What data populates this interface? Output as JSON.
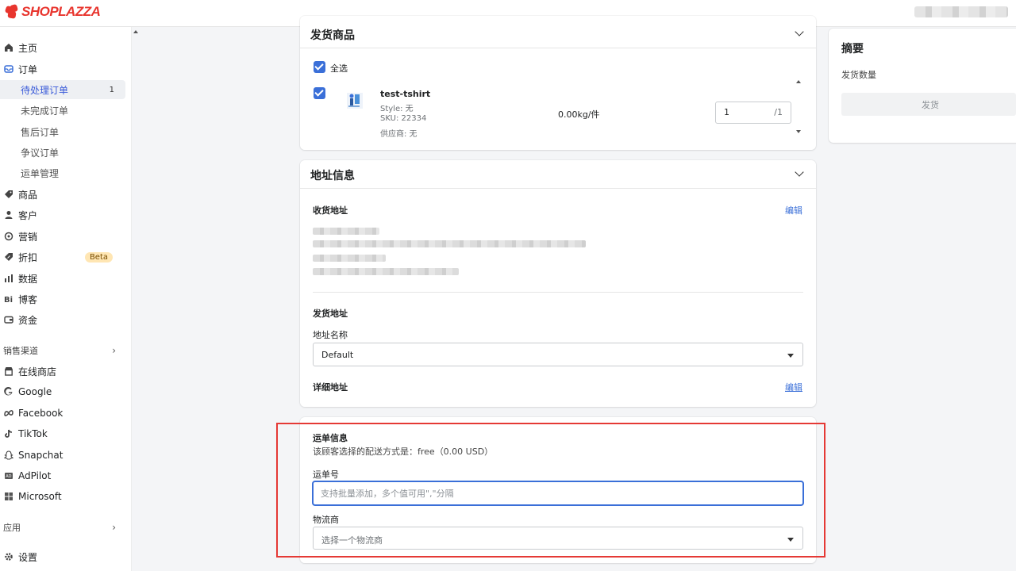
{
  "brand": {
    "name": "SHOPLAZZA",
    "color": "#e8352e"
  },
  "accent": "#3a6fd8",
  "sidebar": {
    "items": [
      {
        "label": "主页",
        "icon": "home-icon"
      },
      {
        "label": "订单",
        "icon": "orders-icon"
      },
      {
        "label": "商品",
        "icon": "tag-icon"
      },
      {
        "label": "客户",
        "icon": "person-icon"
      },
      {
        "label": "营销",
        "icon": "marketing-icon"
      },
      {
        "label": "折扣",
        "icon": "discount-icon",
        "badge": "Beta"
      },
      {
        "label": "数据",
        "icon": "bar-chart-icon"
      },
      {
        "label": "博客",
        "icon": "blog-icon"
      },
      {
        "label": "资金",
        "icon": "wallet-icon"
      }
    ],
    "order_sub": [
      {
        "label": "待处理订单",
        "count": "1",
        "active": true
      },
      {
        "label": "未完成订单"
      },
      {
        "label": "售后订单"
      },
      {
        "label": "争议订单"
      },
      {
        "label": "运单管理"
      }
    ],
    "sales_channels_label": "销售渠道",
    "channels": [
      {
        "label": "在线商店",
        "icon": "store-icon"
      },
      {
        "label": "Google",
        "icon": "google-icon"
      },
      {
        "label": "Facebook",
        "icon": "meta-icon"
      },
      {
        "label": "TikTok",
        "icon": "tiktok-icon"
      },
      {
        "label": "Snapchat",
        "icon": "snapchat-icon"
      },
      {
        "label": "AdPilot",
        "icon": "adpilot-icon"
      },
      {
        "label": "Microsoft",
        "icon": "microsoft-icon"
      }
    ],
    "apps_label": "应用",
    "settings_label": "设置"
  },
  "fulfill": {
    "title": "发货商品",
    "select_all": "全选",
    "product": {
      "name": "test-tshirt",
      "style": "Style: 无",
      "sku": "SKU: 22334",
      "supplier": "供应商: 无",
      "weight": "0.00kg/件",
      "qty": "1",
      "qty_max": "/1"
    }
  },
  "address": {
    "title": "地址信息",
    "shipping_label": "收货地址",
    "edit": "编辑",
    "origin_label": "发货地址",
    "name_label": "地址名称",
    "name_value": "Default",
    "detail_label": "详细地址",
    "detail_edit": "编辑"
  },
  "tracking": {
    "title": "运单信息",
    "method": "该顾客选择的配送方式是：free（0.00 USD）",
    "number_label": "运单号",
    "number_placeholder": "支持批量添加，多个值可用\",\"分隔",
    "carrier_label": "物流商",
    "carrier_placeholder": "选择一个物流商"
  },
  "summary": {
    "title": "摘要",
    "qty_label": "发货数量",
    "button": "发货"
  }
}
